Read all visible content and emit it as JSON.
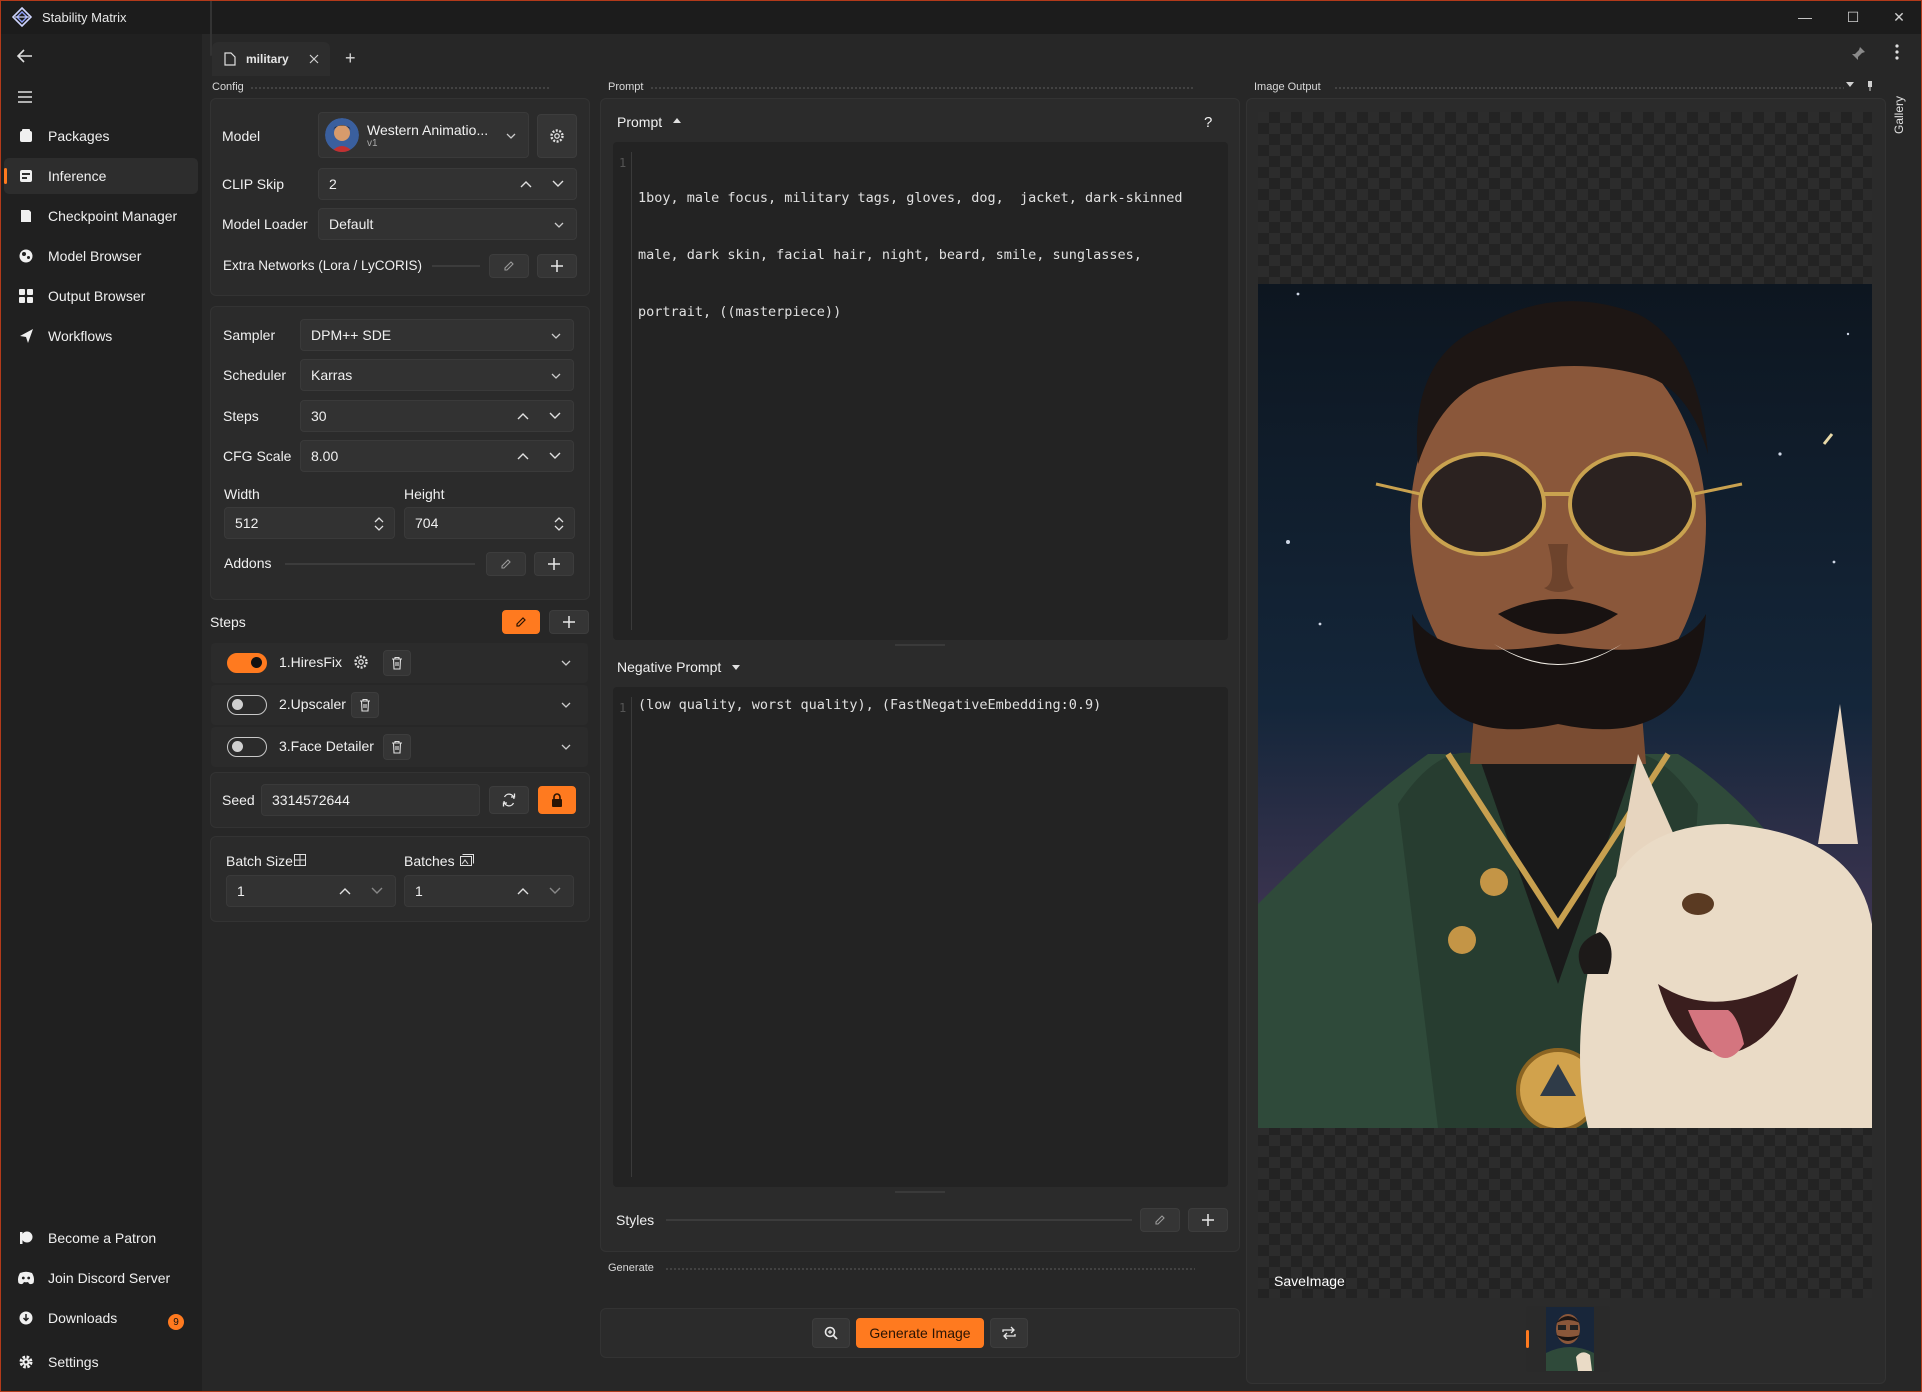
{
  "window": {
    "title": "Stability Matrix",
    "minimize": "—",
    "maximize": "☐",
    "close": "✕"
  },
  "sidebar": {
    "items": [
      {
        "label": "Packages",
        "icon": "package-icon"
      },
      {
        "label": "Inference",
        "icon": "inference-icon",
        "active": true
      },
      {
        "label": "Checkpoint Manager",
        "icon": "checkpoint-icon"
      },
      {
        "label": "Model Browser",
        "icon": "model-browser-icon"
      },
      {
        "label": "Output Browser",
        "icon": "output-browser-icon"
      },
      {
        "label": "Workflows",
        "icon": "workflows-icon"
      }
    ],
    "footer": [
      {
        "label": "Become a Patron",
        "icon": "patreon-icon"
      },
      {
        "label": "Join Discord Server",
        "icon": "discord-icon"
      },
      {
        "label": "Downloads",
        "icon": "downloads-icon",
        "badge": "9"
      },
      {
        "label": "Settings",
        "icon": "settings-icon"
      }
    ]
  },
  "tabs": [
    {
      "label": "military"
    }
  ],
  "add_tab": "+",
  "panes": {
    "config": "Config",
    "prompt": "Prompt",
    "image_output": "Image Output",
    "generate": "Generate",
    "gallery": "Gallery"
  },
  "config": {
    "model_label": "Model",
    "model_name": "Western Animatio...",
    "model_version": "v1",
    "clip_skip_label": "CLIP Skip",
    "clip_skip_value": "2",
    "model_loader_label": "Model Loader",
    "model_loader_value": "Default",
    "extra_networks_label": "Extra Networks (Lora / LyCORIS)",
    "sampler_label": "Sampler",
    "sampler_value": "DPM++ SDE",
    "scheduler_label": "Scheduler",
    "scheduler_value": "Karras",
    "steps_label": "Steps",
    "steps_value": "30",
    "cfg_label": "CFG Scale",
    "cfg_value": "8.00",
    "width_label": "Width",
    "width_value": "512",
    "height_label": "Height",
    "height_value": "704",
    "addons_label": "Addons",
    "steps_section_label": "Steps",
    "modules": [
      {
        "label": "1.HiresFix",
        "enabled": true
      },
      {
        "label": "2.Upscaler",
        "enabled": false
      },
      {
        "label": "3.Face Detailer",
        "enabled": false
      }
    ],
    "seed_label": "Seed",
    "seed_value": "3314572644",
    "batch_size_label": "Batch Size",
    "batch_size_value": "1",
    "batches_label": "Batches",
    "batches_value": "1"
  },
  "prompt": {
    "title": "Prompt",
    "help": "?",
    "line_number": "1",
    "text_line1": "1boy, male focus, military tags, gloves, dog,  jacket, dark-skinned",
    "text_line2": "male, dark skin, facial hair, night, beard, smile, sunglasses,",
    "text_line3": "portrait, ((masterpiece))",
    "negative_title": "Negative Prompt",
    "negative_line_number": "1",
    "negative_text": "(low quality, worst quality), (FastNegativeEmbedding:0.9)",
    "styles_label": "Styles"
  },
  "generate": {
    "button": "Generate Image"
  },
  "image_output": {
    "node_label": "SaveImage"
  },
  "colors": {
    "accent": "#ff7a1f",
    "background": "#202020",
    "panel": "#2b2b2b"
  }
}
